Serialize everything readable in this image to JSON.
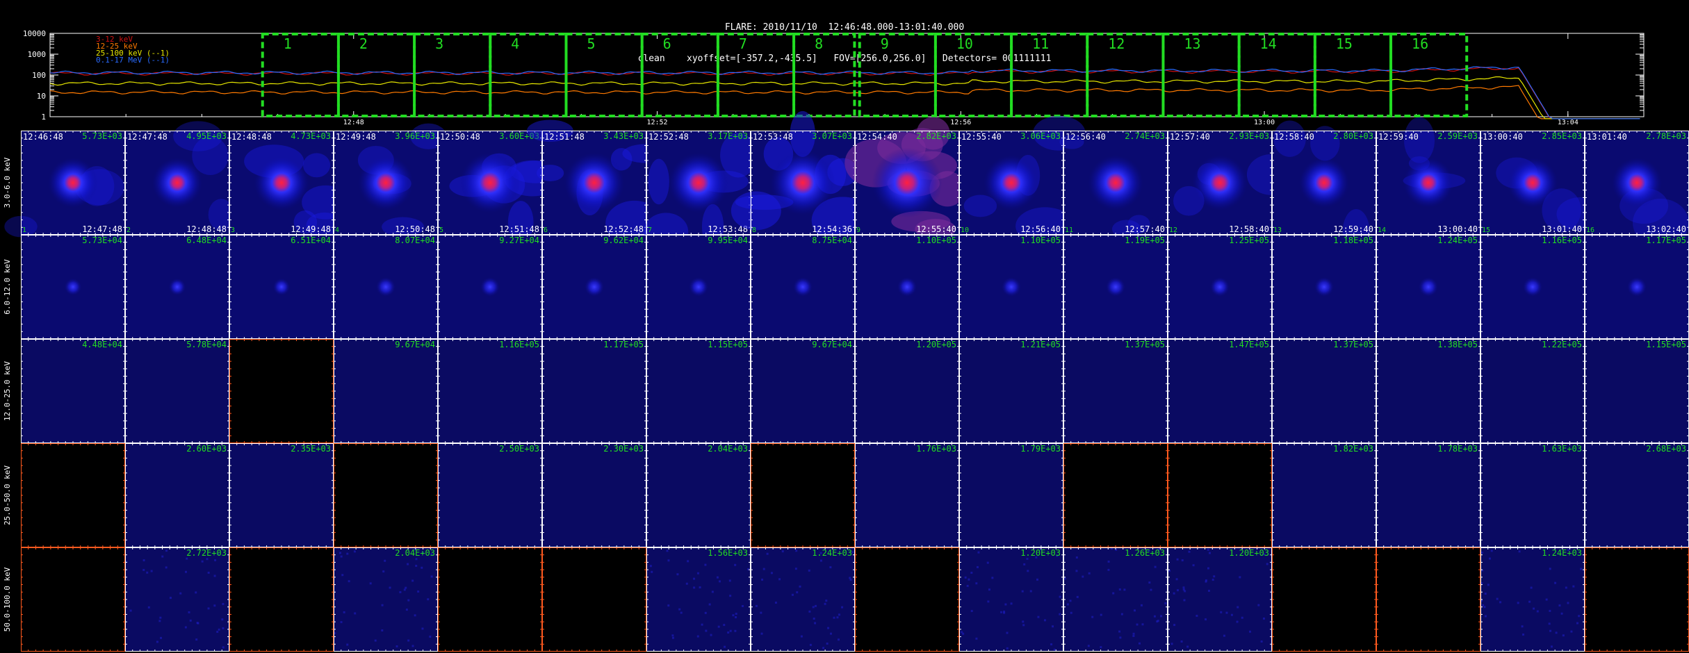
{
  "header": {
    "line1": "FLARE: 2010/11/10  12:46:48.000-13:01:40.000",
    "line2": "clean    xyoffset=[-357.2,-435.5]   FOV=[256.0,256.0]   Detectors= 001111111"
  },
  "chart_data": [
    {
      "type": "line",
      "yscale": "log",
      "ylim": [
        1,
        10000
      ],
      "ytick_labels": [
        "1",
        "10",
        "100",
        "1000",
        "10000"
      ],
      "xlim": [
        "12:44:00",
        "13:05:00"
      ],
      "xtick_labels": [
        "12:48",
        "12:52",
        "12:56",
        "13:00",
        "13:04"
      ],
      "xticks_min": [
        4,
        8,
        12,
        16,
        20
      ],
      "series": [
        {
          "name": "3-12 keV",
          "color": "#d01010",
          "level": 120,
          "drop_at_min": 19.4
        },
        {
          "name": "12-25 keV",
          "color": "#ff7a00",
          "level": 15,
          "drop_at_min": 19.4
        },
        {
          "name": "25-100 keV (--1)",
          "color": "#e6e600",
          "level": 40,
          "drop_at_min": 19.4
        },
        {
          "name": "0.1-17 MeV (--1)",
          "color": "#2a6bff",
          "level": 130,
          "drop_at_min": 19.4
        }
      ],
      "interval_labels": [
        "1",
        "2",
        "3",
        "4",
        "5",
        "6",
        "7",
        "8",
        "9",
        "10",
        "11",
        "12",
        "13",
        "14",
        "15",
        "16"
      ],
      "interval_color": "#22dd22"
    },
    {
      "type": "heatmap",
      "rows": [
        {
          "label": "3.0-6.0 keV",
          "cells": [
            {
              "n": "1",
              "start": "12:46:48",
              "end": "12:47:48",
              "max": "5.73E+03",
              "state": "img",
              "spread": 1.0,
              "bg": 0.25
            },
            {
              "n": "2",
              "start": "12:47:48",
              "end": "12:48:48",
              "max": "4.95E+03",
              "state": "img",
              "spread": 1.0,
              "bg": 0.25
            },
            {
              "n": "3",
              "start": "12:48:48",
              "end": "12:49:48",
              "max": "4.73E+03",
              "state": "img",
              "spread": 1.1,
              "bg": 0.45
            },
            {
              "n": "4",
              "start": "12:49:48",
              "end": "12:50:48",
              "max": "3.96E+03",
              "state": "img",
              "spread": 1.1,
              "bg": 0.35
            },
            {
              "n": "5",
              "start": "12:50:48",
              "end": "12:51:48",
              "max": "3.60E+03",
              "state": "img",
              "spread": 1.2,
              "bg": 0.55
            },
            {
              "n": "6",
              "start": "12:51:48",
              "end": "12:52:48",
              "max": "3.43E+03",
              "state": "img",
              "spread": 1.2,
              "bg": 0.55
            },
            {
              "n": "7",
              "start": "12:52:48",
              "end": "12:53:48",
              "max": "3.17E+03",
              "state": "img",
              "spread": 1.2,
              "bg": 0.5
            },
            {
              "n": "8",
              "start": "12:53:48",
              "end": "12:54:36",
              "max": "3.07E+03",
              "state": "img",
              "spread": 1.3,
              "bg": 0.7
            },
            {
              "n": "9",
              "start": "12:54:40",
              "end": "12:55:40",
              "max": "2.82E+03",
              "state": "img",
              "spread": 1.4,
              "bg": 0.85
            },
            {
              "n": "10",
              "start": "12:55:40",
              "end": "12:56:40",
              "max": "3.06E+03",
              "state": "img",
              "spread": 1.1,
              "bg": 0.35
            },
            {
              "n": "11",
              "start": "12:56:40",
              "end": "12:57:40",
              "max": "2.74E+03",
              "state": "img",
              "spread": 1.1,
              "bg": 0.3
            },
            {
              "n": "12",
              "start": "12:57:40",
              "end": "12:58:40",
              "max": "2.93E+03",
              "state": "img",
              "spread": 1.1,
              "bg": 0.3
            },
            {
              "n": "13",
              "start": "12:58:40",
              "end": "12:59:40",
              "max": "2.80E+03",
              "state": "img",
              "spread": 1.0,
              "bg": 0.25
            },
            {
              "n": "14",
              "start": "12:59:40",
              "end": "13:00:40",
              "max": "2.59E+03",
              "state": "img",
              "spread": 1.0,
              "bg": 0.25
            },
            {
              "n": "15",
              "start": "13:00:40",
              "end": "13:01:40",
              "max": "2.85E+03",
              "state": "img",
              "spread": 1.0,
              "bg": 0.25
            },
            {
              "n": "16",
              "start": "13:01:40",
              "end": "13:02:40",
              "max": "2.78E+03",
              "state": "img",
              "spread": 1.0,
              "bg": 0.2
            }
          ]
        },
        {
          "label": "6.0-12.0 keV",
          "cells": [
            {
              "max": "5.73E+04",
              "state": "img",
              "spread": 0.35,
              "bg": 0.05
            },
            {
              "max": "6.48E+04",
              "state": "img",
              "spread": 0.35,
              "bg": 0.05
            },
            {
              "max": "6.51E+04",
              "state": "img",
              "spread": 0.35,
              "bg": 0.05
            },
            {
              "max": "8.07E+04",
              "state": "img",
              "spread": 0.4,
              "bg": 0.05
            },
            {
              "max": "9.27E+04",
              "state": "img",
              "spread": 0.4,
              "bg": 0.05
            },
            {
              "max": "9.62E+04",
              "state": "img",
              "spread": 0.4,
              "bg": 0.05
            },
            {
              "max": "9.95E+04",
              "state": "img",
              "spread": 0.4,
              "bg": 0.05
            },
            {
              "max": "8.75E+04",
              "state": "img",
              "spread": 0.4,
              "bg": 0.05
            },
            {
              "max": "1.10E+05",
              "state": "img",
              "spread": 0.4,
              "bg": 0.05
            },
            {
              "max": "1.10E+05",
              "state": "img",
              "spread": 0.4,
              "bg": 0.05
            },
            {
              "max": "1.19E+05",
              "state": "img",
              "spread": 0.4,
              "bg": 0.05
            },
            {
              "max": "1.25E+05",
              "state": "img",
              "spread": 0.4,
              "bg": 0.05
            },
            {
              "max": "1.18E+05",
              "state": "img",
              "spread": 0.4,
              "bg": 0.05
            },
            {
              "max": "1.24E+05",
              "state": "img",
              "spread": 0.4,
              "bg": 0.05
            },
            {
              "max": "1.16E+05",
              "state": "img",
              "spread": 0.4,
              "bg": 0.05
            },
            {
              "max": "1.17E+05",
              "state": "img",
              "spread": 0.4,
              "bg": 0.05
            }
          ]
        },
        {
          "label": "12.0-25.0 keV",
          "cells": [
            {
              "max": "4.48E+04",
              "state": "faint"
            },
            {
              "max": "5.78E+04",
              "state": "faint"
            },
            {
              "max": "",
              "state": "blank"
            },
            {
              "max": "9.67E+04",
              "state": "faint"
            },
            {
              "max": "1.16E+05",
              "state": "faint"
            },
            {
              "max": "1.17E+05",
              "state": "faint"
            },
            {
              "max": "1.15E+05",
              "state": "faint"
            },
            {
              "max": "9.67E+04",
              "state": "faint"
            },
            {
              "max": "1.20E+05",
              "state": "faint"
            },
            {
              "max": "1.21E+05",
              "state": "faint"
            },
            {
              "max": "1.37E+05",
              "state": "faint"
            },
            {
              "max": "1.47E+05",
              "state": "faint"
            },
            {
              "max": "1.37E+05",
              "state": "faint"
            },
            {
              "max": "1.38E+05",
              "state": "faint"
            },
            {
              "max": "1.22E+05",
              "state": "faint"
            },
            {
              "max": "1.15E+05",
              "state": "faint"
            }
          ]
        },
        {
          "label": "25.0-50.0 keV",
          "cells": [
            {
              "max": "",
              "state": "blank"
            },
            {
              "max": "2.60E+03",
              "state": "faint"
            },
            {
              "max": "2.35E+03",
              "state": "faint"
            },
            {
              "max": "",
              "state": "blank"
            },
            {
              "max": "2.50E+03",
              "state": "faint"
            },
            {
              "max": "2.30E+03",
              "state": "faint"
            },
            {
              "max": "2.04E+03",
              "state": "faint"
            },
            {
              "max": "",
              "state": "blank"
            },
            {
              "max": "1.76E+03",
              "state": "faint"
            },
            {
              "max": "1.79E+03",
              "state": "faint"
            },
            {
              "max": "",
              "state": "blank"
            },
            {
              "max": "",
              "state": "blank"
            },
            {
              "max": "1.82E+03",
              "state": "faint"
            },
            {
              "max": "1.78E+03",
              "state": "faint"
            },
            {
              "max": "1.63E+03",
              "state": "faint"
            },
            {
              "max": "2.68E+03",
              "state": "faint"
            }
          ]
        },
        {
          "label": "50.0-100.0 keV",
          "cells": [
            {
              "max": "",
              "state": "blank"
            },
            {
              "max": "2.72E+03",
              "state": "noise"
            },
            {
              "max": "",
              "state": "blank"
            },
            {
              "max": "2.04E+03",
              "state": "noise"
            },
            {
              "max": "",
              "state": "blank"
            },
            {
              "max": "",
              "state": "blank"
            },
            {
              "max": "1.56E+03",
              "state": "noise"
            },
            {
              "max": "1.24E+03",
              "state": "noise"
            },
            {
              "max": "",
              "state": "blank"
            },
            {
              "max": "1.20E+03",
              "state": "noise"
            },
            {
              "max": "1.26E+03",
              "state": "noise"
            },
            {
              "max": "1.20E+03",
              "state": "noise"
            },
            {
              "max": "",
              "state": "blank"
            },
            {
              "max": "",
              "state": "blank"
            },
            {
              "max": "1.24E+03",
              "state": "noise"
            },
            {
              "max": "",
              "state": "blank"
            }
          ]
        }
      ]
    }
  ],
  "colors": {
    "background": "#000000",
    "max_label": "#22dd22",
    "time_label": "#ffffff",
    "frame_white": "#ffffff",
    "frame_blank": "#ff5a1f",
    "interval_box": "#22dd22"
  }
}
